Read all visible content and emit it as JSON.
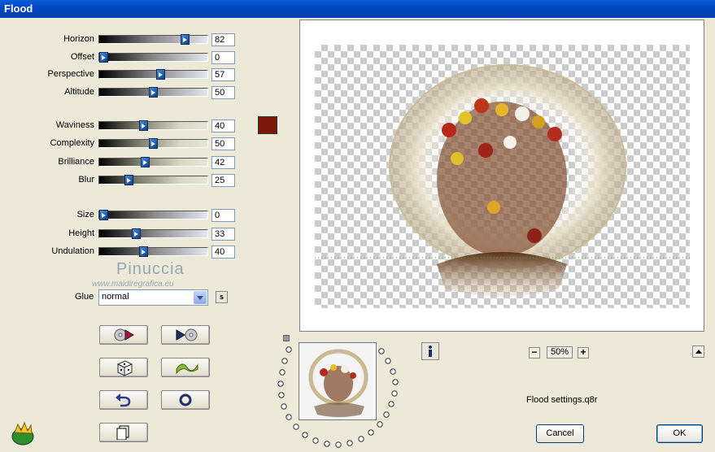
{
  "window": {
    "title": "Flood"
  },
  "params": {
    "horizon": {
      "label": "Horizon",
      "value": "82",
      "frac": 0.82,
      "track": "gray"
    },
    "offset": {
      "label": "Offset",
      "value": "0",
      "frac": 0.0,
      "track": "gray"
    },
    "perspective": {
      "label": "Perspective",
      "value": "57",
      "frac": 0.57,
      "track": "gray"
    },
    "altitude": {
      "label": "Altitude",
      "value": "50",
      "frac": 0.5,
      "track": "gray"
    },
    "waviness": {
      "label": "Waviness",
      "value": "40",
      "frac": 0.4,
      "track": "tan"
    },
    "complexity": {
      "label": "Complexity",
      "value": "50",
      "frac": 0.5,
      "track": "tan"
    },
    "brilliance": {
      "label": "Brilliance",
      "value": "42",
      "frac": 0.42,
      "track": "tan"
    },
    "blur": {
      "label": "Blur",
      "value": "25",
      "frac": 0.25,
      "track": "tan"
    },
    "size": {
      "label": "Size",
      "value": "0",
      "frac": 0.0,
      "track": "gray"
    },
    "height": {
      "label": "Height",
      "value": "33",
      "frac": 0.33,
      "track": "gray"
    },
    "undulation": {
      "label": "Undulation",
      "value": "40",
      "frac": 0.4,
      "track": "gray"
    }
  },
  "color_swatch": "#7a1808",
  "watermark": {
    "name": "Pinuccia",
    "url": "www.maidiregrafica.eu"
  },
  "glue": {
    "label": "Glue",
    "value": "normal",
    "s_label": "s"
  },
  "zoom": {
    "minus": "−",
    "value": "50%",
    "plus": "+"
  },
  "settings_file": "Flood settings.q8r",
  "buttons": {
    "cancel": "Cancel",
    "ok": "OK"
  },
  "icons": {
    "load_preset": "disc-arrow-icon",
    "save_preset": "arrow-disc-icon",
    "randomize": "dice-icon",
    "wave": "wave-icon",
    "undo": "undo-icon",
    "reset": "ring-icon",
    "copy": "document-icon",
    "info": "info-icon"
  }
}
